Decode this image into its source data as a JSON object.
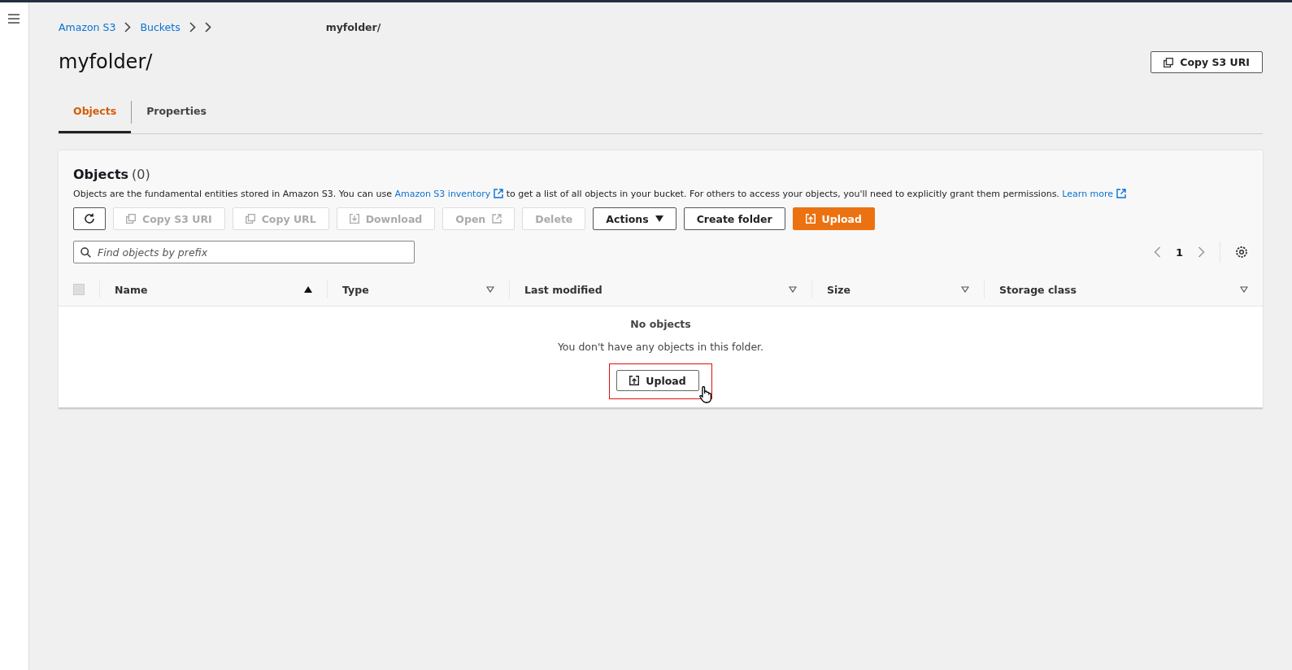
{
  "breadcrumbs": [
    {
      "label": "Amazon S3",
      "link": true
    },
    {
      "label": "Buckets",
      "link": true
    },
    {
      "redacted": true
    },
    {
      "label": "myfolder/",
      "link": false
    }
  ],
  "page_title": "myfolder/",
  "header_button": "Copy S3 URI",
  "tabs": [
    {
      "label": "Objects",
      "selected": true
    },
    {
      "label": "Properties",
      "selected": false
    }
  ],
  "panel": {
    "title": "Objects",
    "count": "(0)",
    "description": [
      {
        "text": "Objects are the fundamental entities stored in Amazon S3. You can use ",
        "link": false
      },
      {
        "text": "Amazon S3 inventory",
        "link": true
      },
      {
        "text": " to get a list of all objects in your bucket. For others to access your objects, you'll need to explicitly grant them permissions. ",
        "link": false
      },
      {
        "text": "Learn more",
        "link": true
      }
    ],
    "toolbar": [
      {
        "kind": "refresh",
        "disabled": false
      },
      {
        "kind": "copy",
        "label": "Copy S3 URI",
        "disabled": true
      },
      {
        "kind": "copy",
        "label": "Copy URL",
        "disabled": true
      },
      {
        "kind": "download",
        "label": "Download",
        "disabled": true
      },
      {
        "kind": "open",
        "label": "Open",
        "disabled": true
      },
      {
        "kind": "plain",
        "label": "Delete",
        "disabled": true
      },
      {
        "kind": "dropdown",
        "label": "Actions",
        "disabled": false
      },
      {
        "kind": "plain",
        "label": "Create folder",
        "disabled": false
      },
      {
        "kind": "upload",
        "label": "Upload",
        "disabled": false
      }
    ],
    "search": {
      "placeholder": "Find objects by prefix"
    },
    "pagination": {
      "page": "1"
    },
    "select_all": {
      "checked": false
    },
    "columns": [
      {
        "label": "Name",
        "sorted": true
      },
      {
        "label": "Type",
        "sorted": false
      },
      {
        "label": "Last modified",
        "sorted": false
      },
      {
        "label": "Size",
        "sorted": false
      },
      {
        "label": "Storage class",
        "sorted": false
      }
    ],
    "empty": {
      "title": "No objects",
      "message": "You don't have any objects in this folder.",
      "button": "Upload",
      "highlighted": true
    }
  }
}
